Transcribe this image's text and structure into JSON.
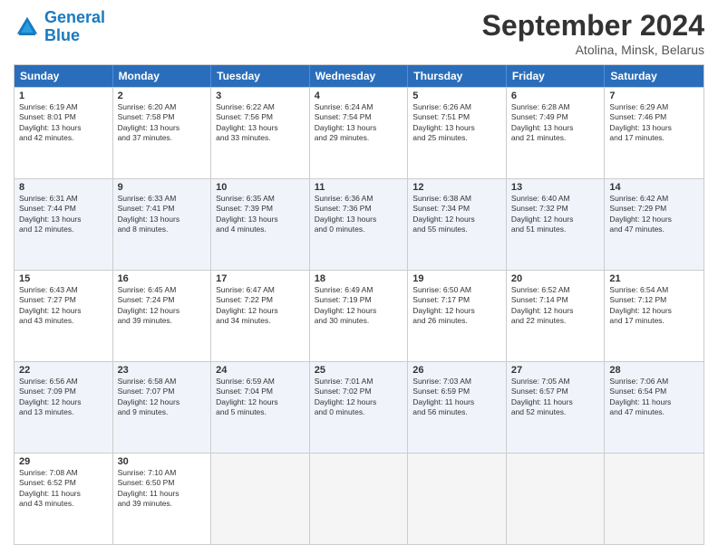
{
  "header": {
    "logo_line1": "General",
    "logo_line2": "Blue",
    "month": "September 2024",
    "location": "Atolina, Minsk, Belarus"
  },
  "days_of_week": [
    "Sunday",
    "Monday",
    "Tuesday",
    "Wednesday",
    "Thursday",
    "Friday",
    "Saturday"
  ],
  "weeks": [
    {
      "alt": false,
      "cells": [
        {
          "day": "1",
          "lines": [
            "Sunrise: 6:19 AM",
            "Sunset: 8:01 PM",
            "Daylight: 13 hours",
            "and 42 minutes."
          ]
        },
        {
          "day": "2",
          "lines": [
            "Sunrise: 6:20 AM",
            "Sunset: 7:58 PM",
            "Daylight: 13 hours",
            "and 37 minutes."
          ]
        },
        {
          "day": "3",
          "lines": [
            "Sunrise: 6:22 AM",
            "Sunset: 7:56 PM",
            "Daylight: 13 hours",
            "and 33 minutes."
          ]
        },
        {
          "day": "4",
          "lines": [
            "Sunrise: 6:24 AM",
            "Sunset: 7:54 PM",
            "Daylight: 13 hours",
            "and 29 minutes."
          ]
        },
        {
          "day": "5",
          "lines": [
            "Sunrise: 6:26 AM",
            "Sunset: 7:51 PM",
            "Daylight: 13 hours",
            "and 25 minutes."
          ]
        },
        {
          "day": "6",
          "lines": [
            "Sunrise: 6:28 AM",
            "Sunset: 7:49 PM",
            "Daylight: 13 hours",
            "and 21 minutes."
          ]
        },
        {
          "day": "7",
          "lines": [
            "Sunrise: 6:29 AM",
            "Sunset: 7:46 PM",
            "Daylight: 13 hours",
            "and 17 minutes."
          ]
        }
      ]
    },
    {
      "alt": true,
      "cells": [
        {
          "day": "8",
          "lines": [
            "Sunrise: 6:31 AM",
            "Sunset: 7:44 PM",
            "Daylight: 13 hours",
            "and 12 minutes."
          ]
        },
        {
          "day": "9",
          "lines": [
            "Sunrise: 6:33 AM",
            "Sunset: 7:41 PM",
            "Daylight: 13 hours",
            "and 8 minutes."
          ]
        },
        {
          "day": "10",
          "lines": [
            "Sunrise: 6:35 AM",
            "Sunset: 7:39 PM",
            "Daylight: 13 hours",
            "and 4 minutes."
          ]
        },
        {
          "day": "11",
          "lines": [
            "Sunrise: 6:36 AM",
            "Sunset: 7:36 PM",
            "Daylight: 13 hours",
            "and 0 minutes."
          ]
        },
        {
          "day": "12",
          "lines": [
            "Sunrise: 6:38 AM",
            "Sunset: 7:34 PM",
            "Daylight: 12 hours",
            "and 55 minutes."
          ]
        },
        {
          "day": "13",
          "lines": [
            "Sunrise: 6:40 AM",
            "Sunset: 7:32 PM",
            "Daylight: 12 hours",
            "and 51 minutes."
          ]
        },
        {
          "day": "14",
          "lines": [
            "Sunrise: 6:42 AM",
            "Sunset: 7:29 PM",
            "Daylight: 12 hours",
            "and 47 minutes."
          ]
        }
      ]
    },
    {
      "alt": false,
      "cells": [
        {
          "day": "15",
          "lines": [
            "Sunrise: 6:43 AM",
            "Sunset: 7:27 PM",
            "Daylight: 12 hours",
            "and 43 minutes."
          ]
        },
        {
          "day": "16",
          "lines": [
            "Sunrise: 6:45 AM",
            "Sunset: 7:24 PM",
            "Daylight: 12 hours",
            "and 39 minutes."
          ]
        },
        {
          "day": "17",
          "lines": [
            "Sunrise: 6:47 AM",
            "Sunset: 7:22 PM",
            "Daylight: 12 hours",
            "and 34 minutes."
          ]
        },
        {
          "day": "18",
          "lines": [
            "Sunrise: 6:49 AM",
            "Sunset: 7:19 PM",
            "Daylight: 12 hours",
            "and 30 minutes."
          ]
        },
        {
          "day": "19",
          "lines": [
            "Sunrise: 6:50 AM",
            "Sunset: 7:17 PM",
            "Daylight: 12 hours",
            "and 26 minutes."
          ]
        },
        {
          "day": "20",
          "lines": [
            "Sunrise: 6:52 AM",
            "Sunset: 7:14 PM",
            "Daylight: 12 hours",
            "and 22 minutes."
          ]
        },
        {
          "day": "21",
          "lines": [
            "Sunrise: 6:54 AM",
            "Sunset: 7:12 PM",
            "Daylight: 12 hours",
            "and 17 minutes."
          ]
        }
      ]
    },
    {
      "alt": true,
      "cells": [
        {
          "day": "22",
          "lines": [
            "Sunrise: 6:56 AM",
            "Sunset: 7:09 PM",
            "Daylight: 12 hours",
            "and 13 minutes."
          ]
        },
        {
          "day": "23",
          "lines": [
            "Sunrise: 6:58 AM",
            "Sunset: 7:07 PM",
            "Daylight: 12 hours",
            "and 9 minutes."
          ]
        },
        {
          "day": "24",
          "lines": [
            "Sunrise: 6:59 AM",
            "Sunset: 7:04 PM",
            "Daylight: 12 hours",
            "and 5 minutes."
          ]
        },
        {
          "day": "25",
          "lines": [
            "Sunrise: 7:01 AM",
            "Sunset: 7:02 PM",
            "Daylight: 12 hours",
            "and 0 minutes."
          ]
        },
        {
          "day": "26",
          "lines": [
            "Sunrise: 7:03 AM",
            "Sunset: 6:59 PM",
            "Daylight: 11 hours",
            "and 56 minutes."
          ]
        },
        {
          "day": "27",
          "lines": [
            "Sunrise: 7:05 AM",
            "Sunset: 6:57 PM",
            "Daylight: 11 hours",
            "and 52 minutes."
          ]
        },
        {
          "day": "28",
          "lines": [
            "Sunrise: 7:06 AM",
            "Sunset: 6:54 PM",
            "Daylight: 11 hours",
            "and 47 minutes."
          ]
        }
      ]
    },
    {
      "alt": false,
      "cells": [
        {
          "day": "29",
          "lines": [
            "Sunrise: 7:08 AM",
            "Sunset: 6:52 PM",
            "Daylight: 11 hours",
            "and 43 minutes."
          ]
        },
        {
          "day": "30",
          "lines": [
            "Sunrise: 7:10 AM",
            "Sunset: 6:50 PM",
            "Daylight: 11 hours",
            "and 39 minutes."
          ]
        },
        {
          "day": "",
          "lines": []
        },
        {
          "day": "",
          "lines": []
        },
        {
          "day": "",
          "lines": []
        },
        {
          "day": "",
          "lines": []
        },
        {
          "day": "",
          "lines": []
        }
      ]
    }
  ]
}
